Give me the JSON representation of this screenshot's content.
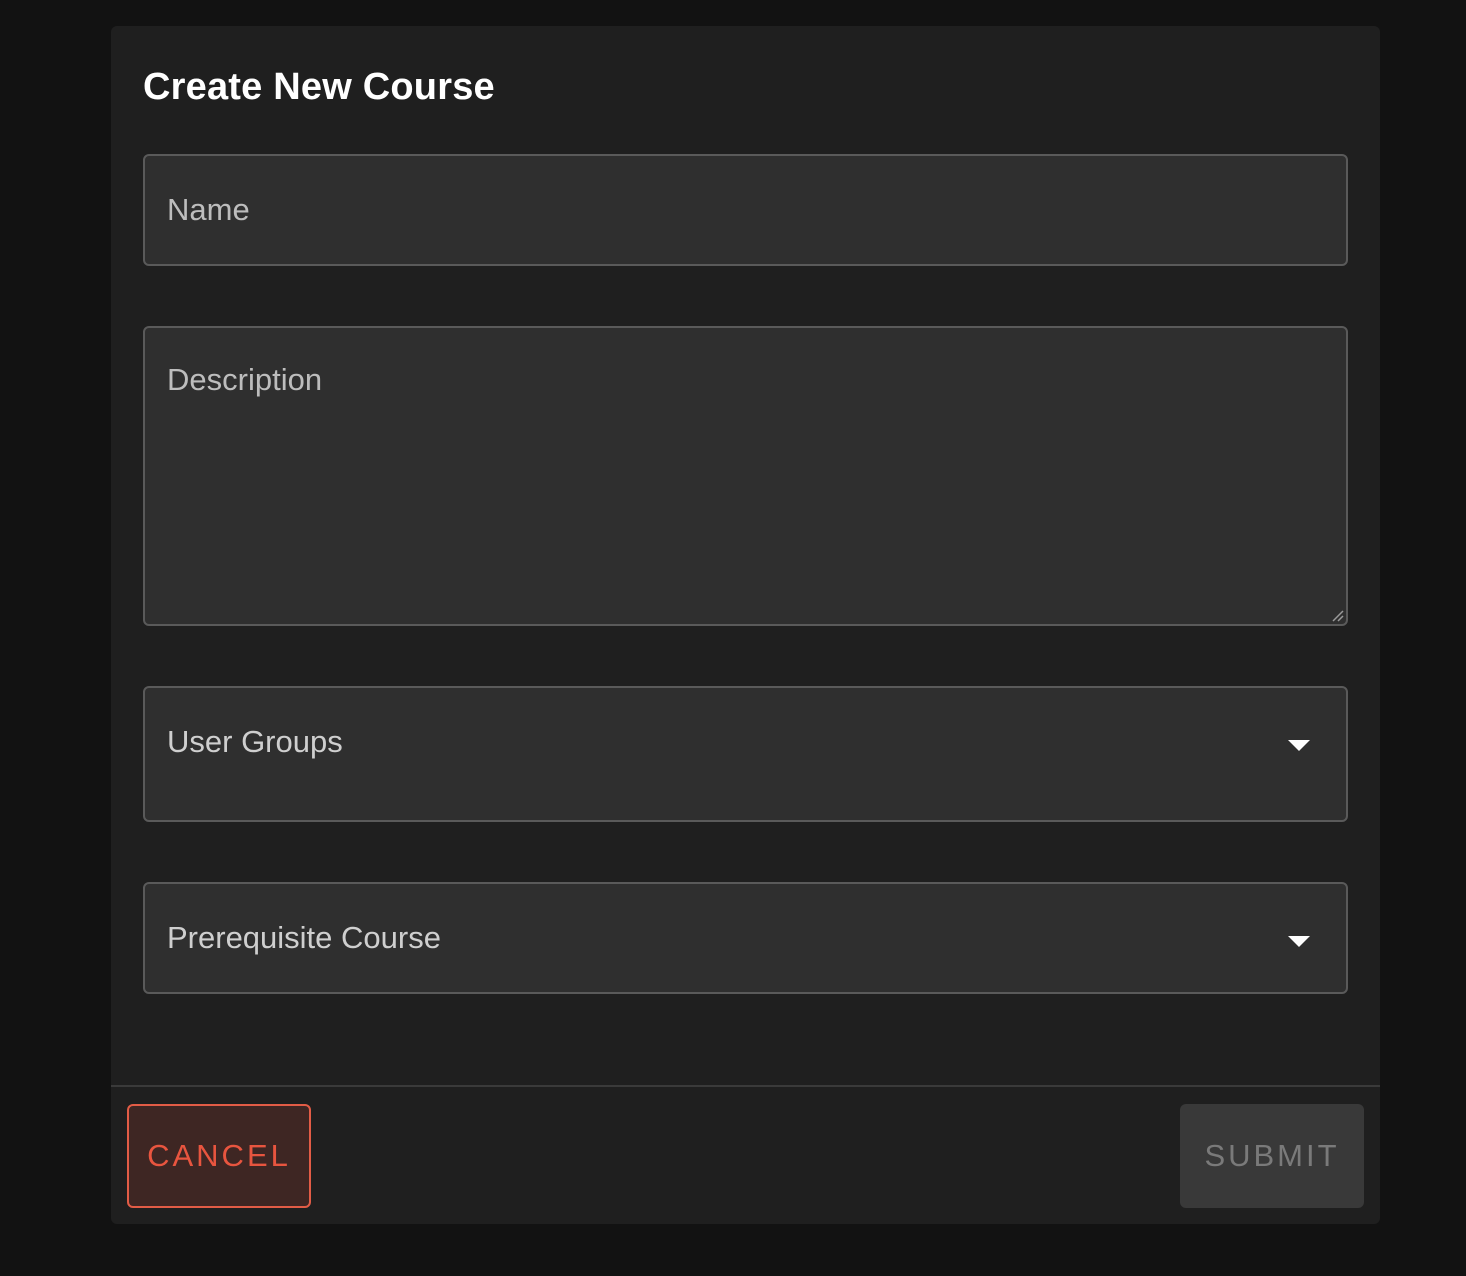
{
  "dialog": {
    "title": "Create New Course"
  },
  "form": {
    "name": {
      "value": "",
      "placeholder": "Name"
    },
    "description": {
      "value": "",
      "placeholder": "Description"
    },
    "user_groups": {
      "label": "User Groups",
      "selected": ""
    },
    "prerequisite_course": {
      "label": "Prerequisite Course",
      "selected": ""
    }
  },
  "actions": {
    "cancel_label": "CANCEL",
    "submit_label": "SUBMIT",
    "submit_disabled": true
  },
  "colors": {
    "background": "#121212",
    "dialog": "#1f1f1f",
    "field": "#2f2f2f",
    "cancel_accent": "#e25c46",
    "submit_disabled": "#393939"
  },
  "icons": {
    "dropdown": "caret-down-icon",
    "resize": "resize-handle-icon"
  }
}
